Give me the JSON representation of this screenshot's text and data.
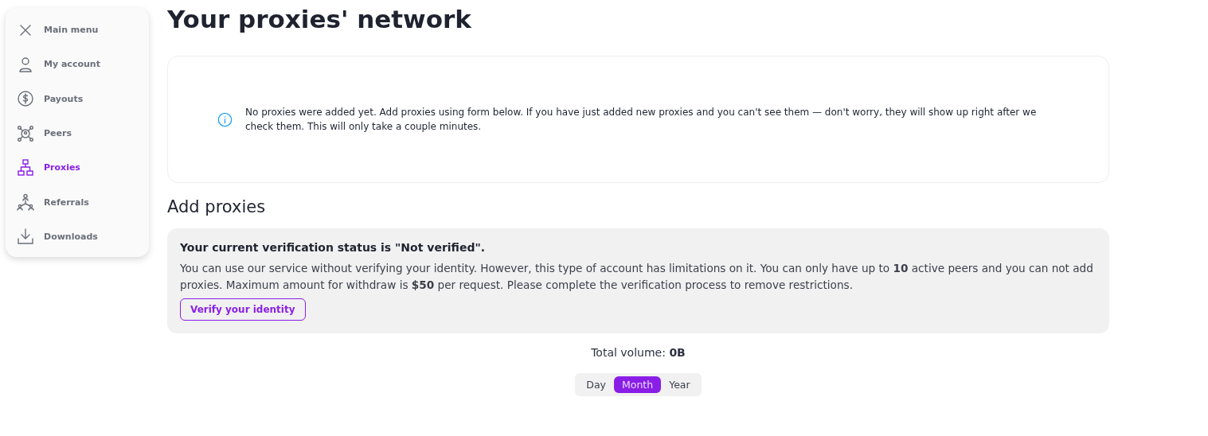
{
  "sidebar": {
    "items": [
      {
        "kind": "close",
        "label": "Main menu",
        "selected": false
      },
      {
        "kind": "account",
        "label": "My account",
        "selected": false
      },
      {
        "kind": "payouts",
        "label": "Payouts",
        "selected": false
      },
      {
        "kind": "peers",
        "label": "Peers",
        "selected": false
      },
      {
        "kind": "proxies",
        "label": "Proxies",
        "selected": true
      },
      {
        "kind": "referrals",
        "label": "Referrals",
        "selected": false
      },
      {
        "kind": "downloads",
        "label": "Downloads",
        "selected": false
      }
    ]
  },
  "title": "Your proxies' network",
  "notice": {
    "text": "No proxies were added yet. Add proxies using form below. If you have just added new proxies and you can't see them — don't worry, they will show up right after we check them. This will only take a couple minutes."
  },
  "add_section": {
    "heading": "Add proxies",
    "verification": {
      "heading": "Your current verification status is \"Not verified\".",
      "text": "You can use our service without verifying your identity. However, this type of account has limitations on it. You can only have up to **10** active peers and you can not add proxies. Maximum amount for withdraw is **$50** per request. Please complete the verification process to remove restrictions.",
      "button": "Verify your identity"
    }
  },
  "total_volume": "Total volume: **0B**",
  "period_tabs": [
    {
      "label": "Day",
      "selected": false
    },
    {
      "label": "Month",
      "selected": true
    },
    {
      "label": "Year",
      "selected": false
    }
  ]
}
